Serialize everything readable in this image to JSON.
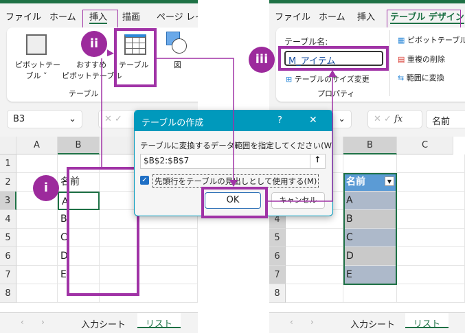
{
  "left": {
    "menu_tabs": [
      "ファイル",
      "ホーム",
      "挿入",
      "描画",
      "ページ レイ"
    ],
    "ribbon": {
      "pivot_table": [
        "ピボットテー",
        "ブル ˅"
      ],
      "recommended_pivot": [
        "おすすめ",
        "ピボットテーブル"
      ],
      "table_button": "テーブル",
      "shapes": "図",
      "group_label": "テーブル"
    },
    "name_box": "B3",
    "columns": [
      "A",
      "B"
    ],
    "rows": [
      "1",
      "2",
      "3",
      "4",
      "5",
      "6",
      "7",
      "8"
    ],
    "cells_b": [
      "",
      "名前",
      "A",
      "B",
      "C",
      "D",
      "E",
      ""
    ],
    "sheet_tabs": [
      "入力シート",
      "リスト"
    ]
  },
  "dialog": {
    "title": "テーブルの作成",
    "help": "?",
    "close": "✕",
    "range_label": "テーブルに変換するデータ範囲を指定してください(W)",
    "range_value": "$B$2:$B$7",
    "header_checkbox_label": "先頭行をテーブルの見出しとして使用する(M)",
    "header_checked": true,
    "ok": "OK",
    "cancel": "キャンセル"
  },
  "right": {
    "menu_tabs": [
      "ファイル",
      "ホーム",
      "挿入",
      "テーブル デザイン"
    ],
    "table_name_label": "テーブル名:",
    "table_name_value": "M_アイテム",
    "resize": "テーブルのサイズ変更",
    "group_properties": "プロパティ",
    "tools": [
      "ピボットテーブル",
      "重複の削除",
      "範囲に変換"
    ],
    "formula_value": "名前",
    "fx": "fx",
    "columns": [
      "B",
      "C"
    ],
    "rows": [
      "4",
      "5",
      "6",
      "7",
      "8"
    ],
    "table_header": "名前",
    "table_values": [
      "A",
      "B",
      "C",
      "D",
      "E"
    ],
    "sheet_tabs": [
      "入力シート",
      "リスト"
    ]
  },
  "steps": [
    "i",
    "ii",
    "iii"
  ],
  "colors": {
    "accent": "#a033a6",
    "excel_green": "#1e7145",
    "dialog_title": "#0099bc",
    "table_header": "#5b9bd5"
  }
}
